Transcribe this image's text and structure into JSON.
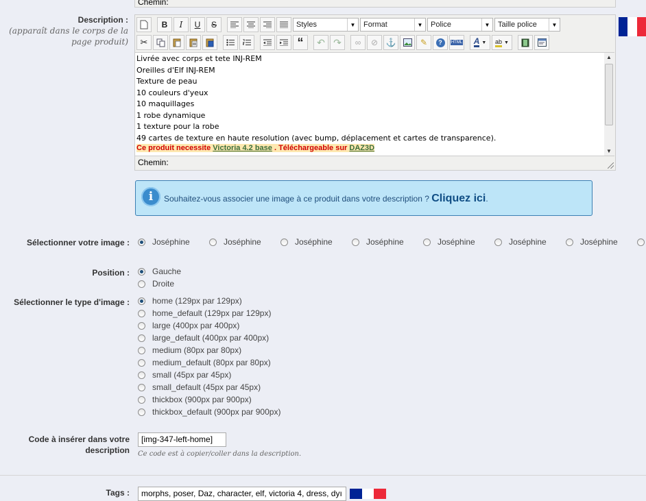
{
  "previous_editor": {
    "path_label": "Chemin:"
  },
  "description": {
    "label": "Description :",
    "hint": "(apparaît dans le corps de la page produit)",
    "toolbar": {
      "styles": "Styles",
      "format": "Format",
      "police": "Police",
      "taille": "Taille police"
    },
    "lines": [
      "Livrée avec corps et tete INJ-REM",
      "Oreilles d'Elf INJ-REM",
      "Texture de peau",
      "10 couleurs d'yeux",
      "10 maquillages",
      "1 robe dynamique",
      "1 texture pour la robe",
      "49 cartes de texture en haute resolution (avec bump, déplacement et cartes de transparence)."
    ],
    "notice": {
      "prefix": "Ce produit necessite ",
      "link1": "Victoria 4.2 base",
      "middle": " . Téléchargeable sur ",
      "link2": "DAZ3D"
    },
    "path_label": "Chemin:"
  },
  "info_box": {
    "text": "Souhaitez-vous associer une image à ce produit dans votre description ? ",
    "link": "Cliquez ici",
    "suffix": "."
  },
  "image_select": {
    "label": "Sélectionner votre image :",
    "options": [
      "Joséphine",
      "Joséphine",
      "Joséphine",
      "Joséphine",
      "Joséphine",
      "Joséphine",
      "Joséphine"
    ],
    "selected": 0
  },
  "position": {
    "label": "Position :",
    "options": [
      "Gauche",
      "Droite"
    ],
    "selected": 0
  },
  "image_type": {
    "label": "Sélectionner le type d'image :",
    "options": [
      "home (129px par 129px)",
      "home_default (129px par 129px)",
      "large (400px par 400px)",
      "large_default (400px par 400px)",
      "medium (80px par 80px)",
      "medium_default (80px par 80px)",
      "small (45px par 45px)",
      "small_default (45px par 45px)",
      "thickbox (900px par 900px)",
      "thickbox_default (900px par 900px)"
    ],
    "selected": 0
  },
  "code": {
    "label_line1": "Code à insérer dans votre",
    "label_line2": "description",
    "value": "[img-347-left-home]",
    "hint": "Ce code est à copier/coller dans la description."
  },
  "tags": {
    "label": "Tags :",
    "value": "morphs, poser, Daz, character, elf, victoria 4, dress, dyı"
  },
  "colors": {
    "flag_blue": "#002395",
    "flag_white": "#ffffff",
    "flag_red": "#ed2939",
    "info_bg": "#bde5f8"
  }
}
